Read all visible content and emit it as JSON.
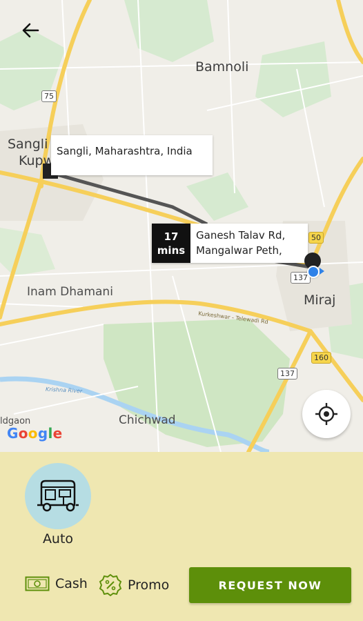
{
  "map": {
    "places": {
      "bamnoli": "Bamnoli",
      "sangli": "Sangli",
      "kupwad": "Kupw",
      "inam_dhamani": "Inam Dhamani",
      "miraj": "Miraj",
      "chichwad": "Chichwad",
      "aldgaon": "ldgaon"
    },
    "river_label": "Krishna River",
    "road_label": "Kurkeshwar - Telewadi Rd",
    "route_shields": [
      "75",
      "137",
      "160",
      "137",
      "160",
      "50"
    ],
    "origin": {
      "address": "Sangli, Maharashtra, India"
    },
    "destination": {
      "line1": "Ganesh Talav Rd,",
      "line2": "Mangalwar Peth,"
    },
    "eta": {
      "value": "17",
      "unit": "mins"
    },
    "attribution": "Google"
  },
  "icons": {
    "back": "arrow-left-icon",
    "locate": "my-location-icon",
    "vehicle": "auto-rickshaw-icon",
    "cash": "cash-icon",
    "promo": "percent-badge-icon"
  },
  "booking": {
    "vehicle_label": "Auto",
    "payment_label": "Cash",
    "promo_label": "Promo",
    "request_label": "REQUEST NOW"
  },
  "colors": {
    "panel_bg": "#efe7b1",
    "vehicle_bg": "#b6dde3",
    "request_bg": "#5d8f0a",
    "icon_green": "#5d8f0a",
    "location_blue": "#2f82e8"
  }
}
